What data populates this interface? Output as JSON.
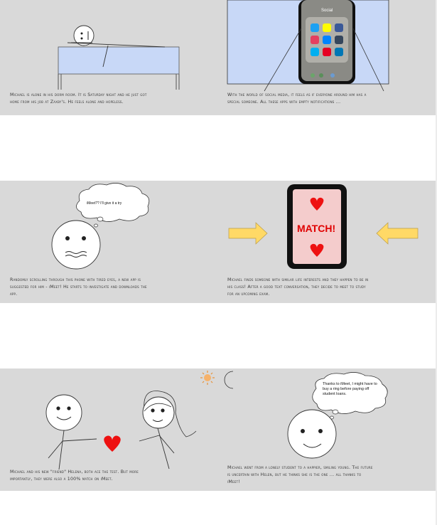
{
  "panels": {
    "p1": {
      "caption": "Michael is alone in his dorm room. It is Saturday night and he just got home from his job at Zaxby's. He feels alone and hopeless."
    },
    "p2": {
      "caption": "With the world of social media, it feels as if everyone around him has a special someone. All these apps with empty notifications ...",
      "folder_label": "Social"
    },
    "p3": {
      "caption": "Randomly scrolling through this phone with tired eyes, a new app is suggested for him - iMeet! He starts to investigate and downloads the app.",
      "bubble": "iMeet?? I'll give it a try"
    },
    "p4": {
      "caption": "Michael finds someone with similar life interests and they happen to be in his class! After a good text conversation, they decide to meet to study for an upcoming exam.",
      "match_text": "MATCH!"
    },
    "p5": {
      "caption": "Michael and his new \"friend\" Helena, both ace the test. But more importantly, they were also a 100% match on iMeet."
    },
    "p6": {
      "caption": "Michael went from a lonely student to a happier, smiling young. The future is uncertain with Helen, but he thinks she is the one ... all thanks to iMeet!",
      "bubble": "Thanks to iMeet, I might have to buy a ring before paying off student loans."
    }
  },
  "colors": {
    "panel_bg": "#d9d9d9",
    "bed": "#c8d8f7",
    "arrow": "#ffd966",
    "heart": "#ee1111"
  }
}
